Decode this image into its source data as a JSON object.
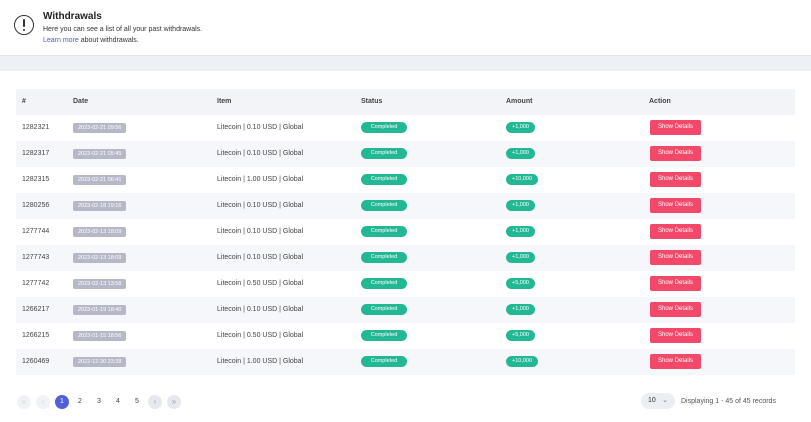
{
  "info": {
    "title": "Withdrawals",
    "description": "Here you can see a list of all your past withdrawals.",
    "learn_more_link": "Learn more",
    "learn_more_suffix": " about withdrawals."
  },
  "table": {
    "headers": [
      "#",
      "Date",
      "Item",
      "Status",
      "Amount",
      "Action"
    ],
    "rows": [
      {
        "id": "1282321",
        "date": "2023-02-21 09:56",
        "item": "Litecoin | 0.10 USD | Global",
        "status": "Completed",
        "amount": "+1,000",
        "action": "Show Details"
      },
      {
        "id": "1282317",
        "date": "2023-02-21 05:45",
        "item": "Litecoin | 0.10 USD | Global",
        "status": "Completed",
        "amount": "+1,000",
        "action": "Show Details"
      },
      {
        "id": "1282315",
        "date": "2023-02-21 06:41",
        "item": "Litecoin | 1.00 USD | Global",
        "status": "Completed",
        "amount": "+10,000",
        "action": "Show Details"
      },
      {
        "id": "1280256",
        "date": "2023-02-18 19:16",
        "item": "Litecoin | 0.10 USD | Global",
        "status": "Completed",
        "amount": "+1,000",
        "action": "Show Details"
      },
      {
        "id": "1277744",
        "date": "2023-02-13 18:09",
        "item": "Litecoin | 0.10 USD | Global",
        "status": "Completed",
        "amount": "+1,000",
        "action": "Show Details"
      },
      {
        "id": "1277743",
        "date": "2023-02-13 18:09",
        "item": "Litecoin | 0.10 USD | Global",
        "status": "Completed",
        "amount": "+1,000",
        "action": "Show Details"
      },
      {
        "id": "1277742",
        "date": "2023-02-13 13:58",
        "item": "Litecoin | 0.50 USD | Global",
        "status": "Completed",
        "amount": "+5,000",
        "action": "Show Details"
      },
      {
        "id": "1266217",
        "date": "2023-01-19 18:40",
        "item": "Litecoin | 0.10 USD | Global",
        "status": "Completed",
        "amount": "+1,000",
        "action": "Show Details"
      },
      {
        "id": "1266215",
        "date": "2023-01-15 18:56",
        "item": "Litecoin | 0.50 USD | Global",
        "status": "Completed",
        "amount": "+5,000",
        "action": "Show Details"
      },
      {
        "id": "1260469",
        "date": "2022-12-30 23:38",
        "item": "Litecoin | 1.00 USD | Global",
        "status": "Completed",
        "amount": "+10,000",
        "action": "Show Details"
      }
    ]
  },
  "pagination": {
    "first": "«",
    "prev": "‹",
    "pages": [
      "1",
      "2",
      "3",
      "4",
      "5"
    ],
    "current": "1",
    "next": "›",
    "last": "»",
    "page_size": "10",
    "records_text": "Displaying 1 - 45 of 45 records"
  },
  "colors": {
    "accent": "#5160d8",
    "completed": "#23b894",
    "action_button": "#f2486a",
    "date_badge": "#b6b8c8"
  }
}
